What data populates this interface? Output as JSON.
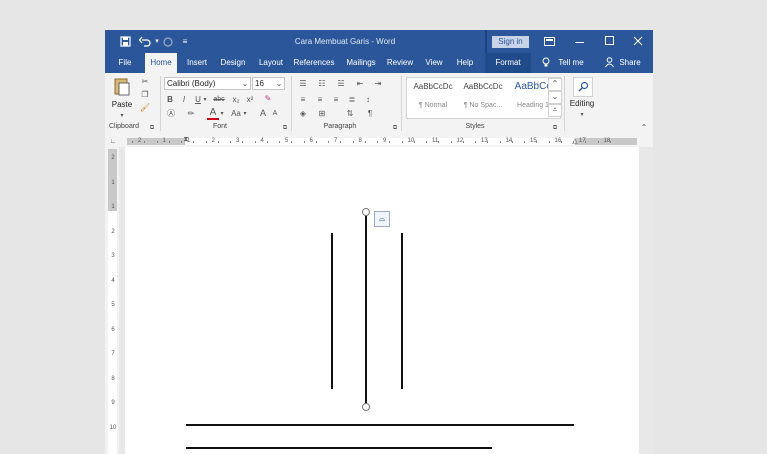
{
  "window": {
    "title": "Cara Membuat Garis  -  Word",
    "signin_label": "Sign in",
    "quick_access": {
      "save_icon": "save-icon",
      "undo_icon": "undo-icon",
      "redo_icon": "redo-icon",
      "customize_icon": "customize-icon"
    },
    "controls": {
      "display_icon": "ribbon-display-icon",
      "min_icon": "minimize-icon",
      "max_icon": "maximize-icon",
      "close_icon": "close-icon"
    }
  },
  "tabs": [
    {
      "label": "File"
    },
    {
      "label": "Home",
      "active": true
    },
    {
      "label": "Insert"
    },
    {
      "label": "Design"
    },
    {
      "label": "Layout"
    },
    {
      "label": "References"
    },
    {
      "label": "Mailings"
    },
    {
      "label": "Review"
    },
    {
      "label": "View"
    },
    {
      "label": "Help"
    },
    {
      "label": "Format"
    }
  ],
  "tell_me": "Tell me",
  "share": "Share",
  "ribbon": {
    "clipboard": {
      "label": "Clipboard",
      "paste": "Paste"
    },
    "font": {
      "label": "Font",
      "name": "Calibri (Body)",
      "size": "16",
      "bold": "B",
      "italic": "I",
      "underline": "U",
      "strike": "abc",
      "subscript": "x₂",
      "superscript": "x²",
      "grow": "A",
      "shrink": "A",
      "case": "Aa",
      "font_color": "A"
    },
    "paragraph": {
      "label": "Paragraph"
    },
    "styles": {
      "label": "Styles",
      "items": [
        {
          "preview": "AaBbCcDc",
          "name": "¶ Normal"
        },
        {
          "preview": "AaBbCcDc",
          "name": "¶ No Spac..."
        },
        {
          "preview": "AaBbCc",
          "name": "Heading 1"
        }
      ]
    },
    "editing": {
      "label": "Editing"
    }
  },
  "ruler": {
    "numbers": [
      "2",
      "1",
      "1",
      "2",
      "3",
      "4",
      "5",
      "6",
      "7",
      "8",
      "9",
      "10",
      "11",
      "12",
      "13",
      "14",
      "15",
      "16",
      "17",
      "18"
    ]
  },
  "vruler": {
    "numbers": [
      "2",
      "1",
      "1",
      "2",
      "3",
      "4",
      "5",
      "6",
      "7",
      "8",
      "9",
      "10"
    ]
  }
}
